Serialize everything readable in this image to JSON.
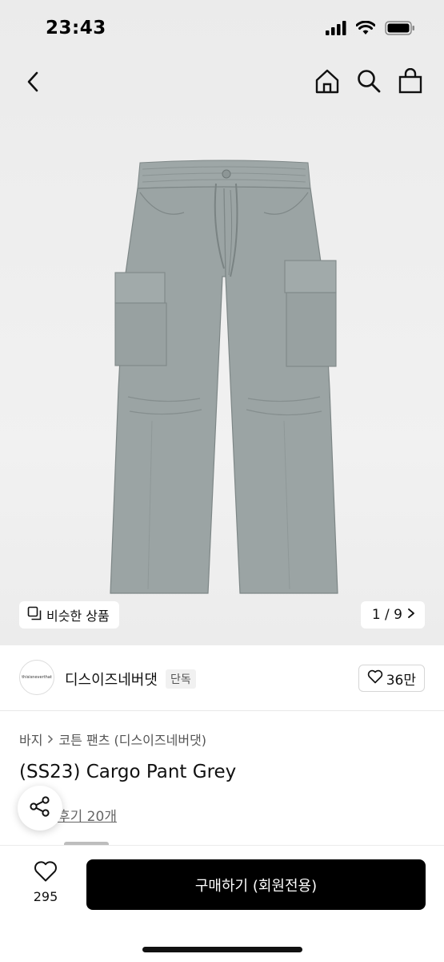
{
  "status_bar": {
    "time": "23:43",
    "icons": [
      "signal-icon",
      "wifi-icon",
      "battery-icon"
    ]
  },
  "nav": {
    "back_icon": "chevron-left-icon",
    "icons": [
      "home-icon",
      "search-icon",
      "shopping-bag-icon"
    ]
  },
  "gallery": {
    "similar_label": "비슷한 상품",
    "page_counter": "1 / 9"
  },
  "brand": {
    "logo_text": "thisisneverthat",
    "name": "디스이즈네버댓",
    "tag": "단독",
    "like_count": "36만"
  },
  "breadcrumb": {
    "items": [
      "바지",
      "코튼 팬츠 (디스이즈네버댓)"
    ]
  },
  "product": {
    "title": "(SS23) Cargo Pant Grey",
    "review_link": "후기 20개"
  },
  "bottom_bar": {
    "wish_count": "295",
    "buy_label": "구매하기 (회원전용)"
  },
  "colors": {
    "product_grey": "#9aa3a3",
    "buy_button": "#000000",
    "accent_star": "#f5a623"
  }
}
